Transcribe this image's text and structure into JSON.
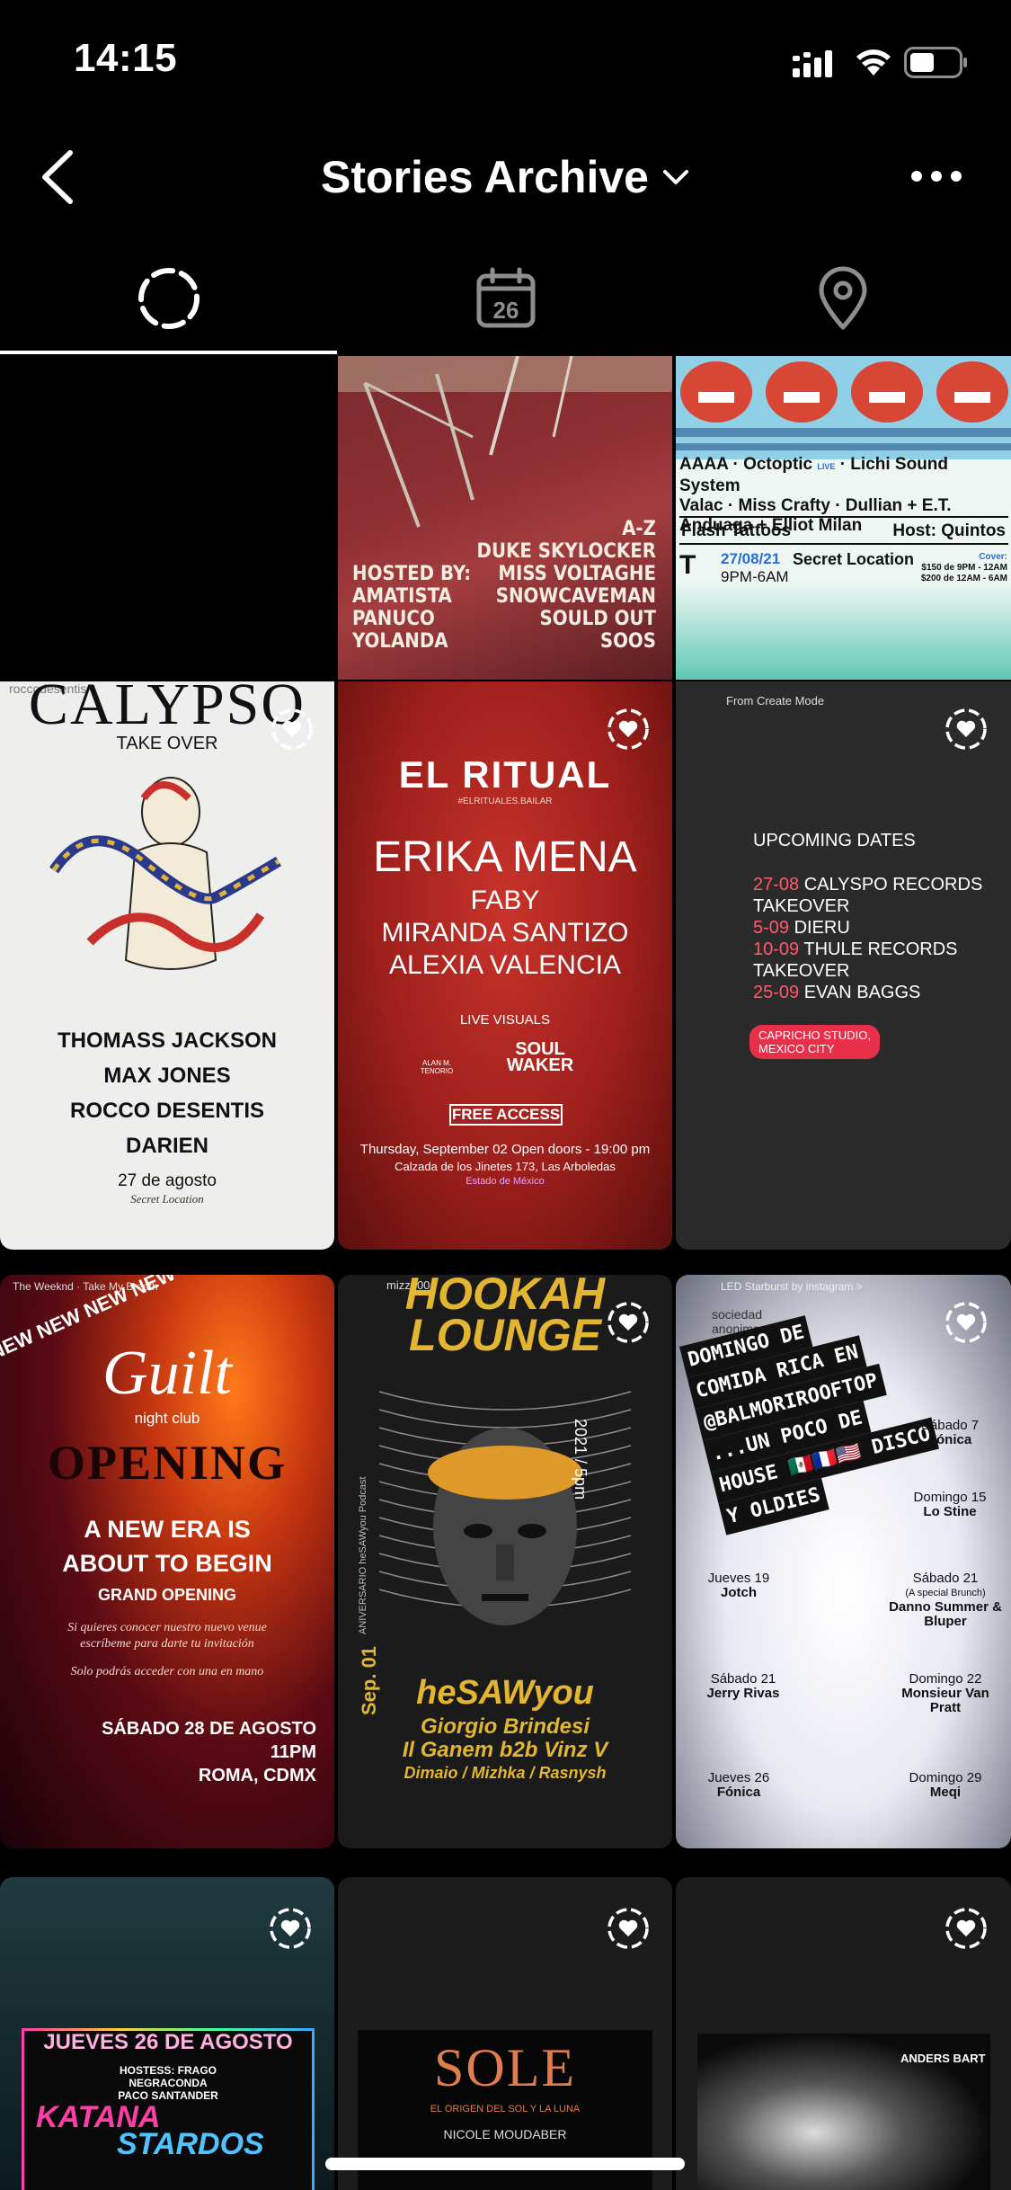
{
  "status_bar": {
    "time": "14:15"
  },
  "header": {
    "title": "Stories Archive"
  },
  "tabs": [
    {
      "name": "stories"
    },
    {
      "name": "calendar",
      "day": "26"
    },
    {
      "name": "location"
    }
  ],
  "stories": {
    "s2": {
      "line1": "A-Z",
      "line2": "DUKE SKYLOCKER",
      "line3": "MISS VOLTAGHE",
      "line4": "SNOWCAVEMAN",
      "line5": "SOULD OUT",
      "line6": "SOOS",
      "hosted": "HOSTED BY:",
      "h1": "AMATISTA",
      "h2": "PANUCO",
      "h3": "YOLANDA"
    },
    "s3": {
      "artists1": "AAAA · Octoptic",
      "live": "LIVE",
      "artists1b": "· Lichi Sound System",
      "artists2": "Valac · Miss Crafty · Dullian + E.T.",
      "artists3": "Anduaga + Elliot Milan",
      "flash": "Flash Tattoos",
      "host": "Host: Quintos",
      "date": "27/08/21",
      "time": "9PM-6AM",
      "location": "Secret Location",
      "cover": "Cover:",
      "price1": "$150 de 9PM - 12AM",
      "price2": "$200 de 12AM - 6AM"
    },
    "s4": {
      "user": "roccodesentis",
      "brand": "CALYPSO",
      "sub": "TAKE OVER",
      "a1": "THOMASS JACKSON",
      "a2": "MAX JONES",
      "a3": "ROCCO DESENTIS",
      "a4": "DARIEN",
      "date": "27 de agosto",
      "loc": "Secret Location"
    },
    "s5": {
      "brand": "EL RITUAL",
      "tag": "#ELRITUALES.BAILAR",
      "a1": "ERIKA MENA",
      "a2": "FABY",
      "a3": "MIRANDA SANTIZO",
      "a4": "ALEXIA VALENCIA",
      "visuals": "LIVE VISUALS",
      "v1": "ALAN M. TENORIO",
      "v2": "SOUL WAKER",
      "access": "FREE ACCESS",
      "when": "Thursday, September 02 Open doors - 19:00 pm",
      "where": "Calzada de los Jinetes 173, Las Arboledas",
      "state": "Estado de México"
    },
    "s6": {
      "from": "From Create Mode",
      "heading": "UPCOMING DATES",
      "d1": "27-08",
      "e1": "CALYSPO RECORDS",
      "e1b": "TAKEOVER",
      "d2": "5-09",
      "e2": "DIERU",
      "d3": "10-09",
      "e3": "THULE RECORDS",
      "e3b": "TAKEOVER",
      "d4": "25-09",
      "e4": "EVAN BAGGS",
      "tag1": "CAPRICHO STUDIO,",
      "tag2": "MEXICO CITY"
    },
    "s7": {
      "music": "The Weeknd · Take My Breath",
      "ribbon": "NEW NEW NEW NEW",
      "brand": "Guilt",
      "sub": "night club",
      "opening": "OPENING",
      "l1": "A NEW ERA IS",
      "l2": "ABOUT TO BEGIN",
      "l3": "GRAND OPENING",
      "i1": "Si quieres conocer nuestro nuevo venue",
      "i2": "escríbeme para darte tu invitación",
      "i3": "Solo podrás  acceder con una en mano",
      "date": "SÁBADO 28 DE AGOSTO",
      "time": "11PM",
      "city": "ROMA, CDMX"
    },
    "s8": {
      "user": "mizzh00",
      "brand1": "HOOKAH",
      "brand2": "LOUNGE",
      "year": "2021 / 5pm",
      "sep": "Sep. 01",
      "side": "ANIVERSARIO heSAWyou Podcast",
      "act": "heSAWyou",
      "a1": "Giorgio Brindesi",
      "a2": "Il Ganem b2b Vinz V",
      "a3": "Dimaio / Mizhka / Rasnysh"
    },
    "s9": {
      "music": "LED Starburst by instagram >",
      "agency": "sociedad anonima",
      "banner1": "DOMINGO DE",
      "banner2": "COMIDA RICA EN",
      "banner3": "@BALMORIROOFTOP",
      "banner4": "...UN POCO DE",
      "banner5": "HOUSE",
      "banner6": "DISCO",
      "banner7": "Y OLDIES",
      "sab7": "Sábado 7",
      "sab7b": "Fónica",
      "dom15": "Domingo 15",
      "dom15b": "Lo Stine",
      "jue19": "Jueves 19",
      "jue19b": "Jotch",
      "sab21": "Sábado 21",
      "sab21s": "(A special Brunch)",
      "sab21b": "Danno Summer & Bluper",
      "sab21c": "Sábado 21",
      "sab21d": "Jerry Rivas",
      "dom22": "Domingo 22",
      "dom22b": "Monsieur Van Pratt",
      "jue26": "Jueves 26",
      "jue26b": "Fónica",
      "dom29": "Domingo 29",
      "dom29b": "Meqi"
    },
    "s10": {
      "date": "JUEVES 26 DE AGOSTO",
      "hosts1": "HOSTESS: FRAGO",
      "hosts2": "NEGRACONDA",
      "hosts3": "PACO SANTANDER",
      "title1": "KATANA",
      "title2": "STARDOS"
    },
    "s11": {
      "brand": "SOLE",
      "sub": "EL ORIGEN DEL SOL Y LA LUNA",
      "act": "NICOLE MOUDABER"
    },
    "s12": {
      "name": "ANDERS BART"
    }
  }
}
